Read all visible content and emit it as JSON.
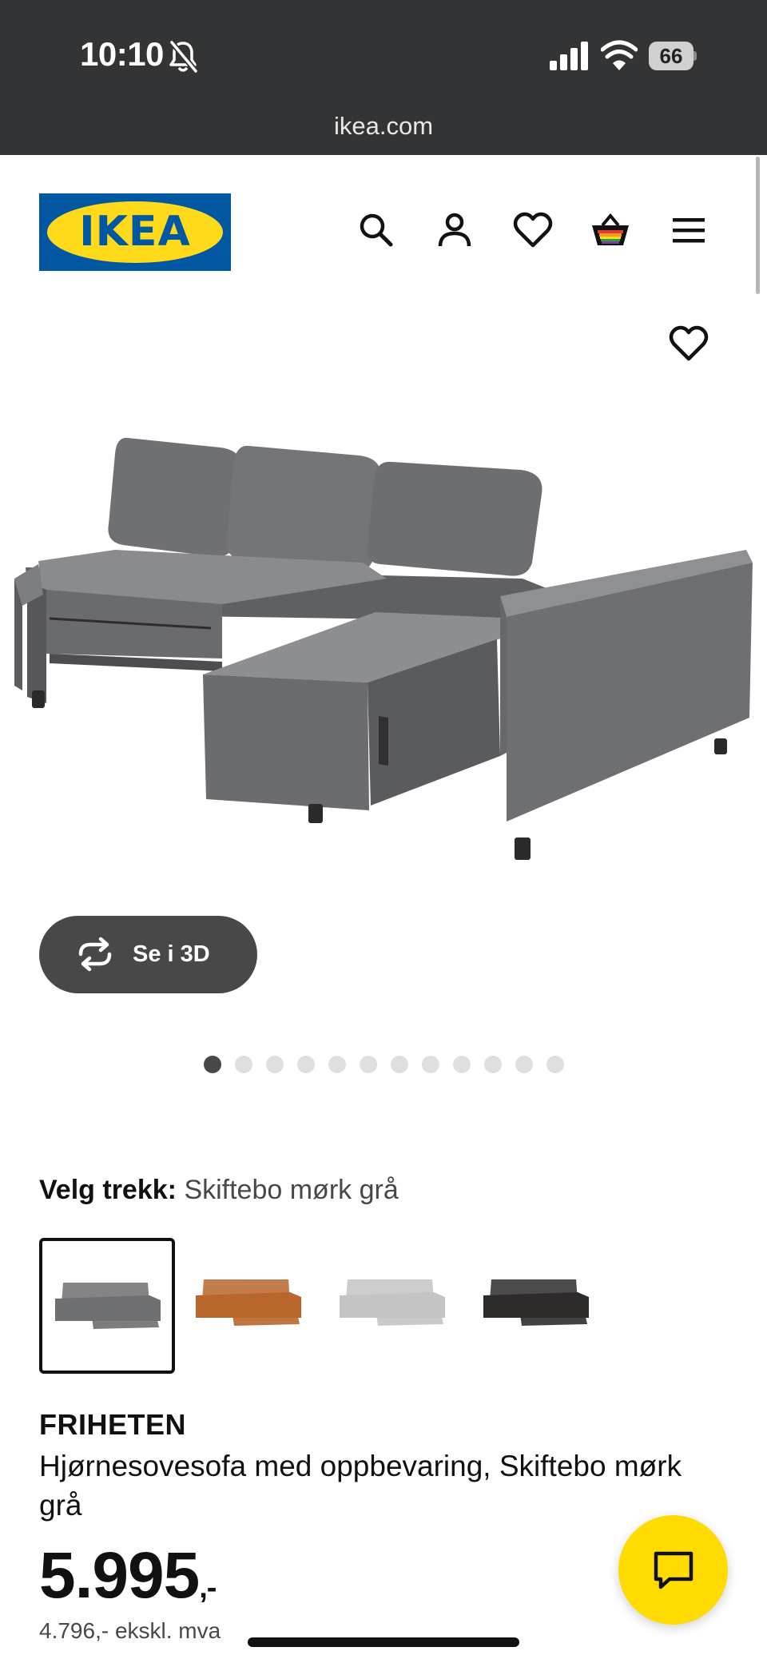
{
  "status_bar": {
    "time": "10:10",
    "battery": "66",
    "icons": [
      "bell-slash-icon",
      "cellular-signal-icon",
      "wifi-icon",
      "battery-icon"
    ]
  },
  "browser": {
    "url": "ikea.com"
  },
  "header": {
    "logo_text": "IKEA",
    "icons": [
      "search-icon",
      "account-icon",
      "heart-icon",
      "shopping-bag-icon",
      "menu-icon"
    ]
  },
  "gallery": {
    "view_3d_label": "Se i 3D",
    "slide_count": 12,
    "active_slide": 1
  },
  "cover_selection": {
    "label": "Velg trekk:",
    "value": "Skiftebo mørk grå",
    "swatches": [
      {
        "color": "#6e6f71",
        "selected": true
      },
      {
        "color": "#b8662b",
        "selected": false
      },
      {
        "color": "#c4c4c4",
        "selected": false
      },
      {
        "color": "#2e2c2b",
        "selected": false
      }
    ]
  },
  "product": {
    "name": "FRIHETEN",
    "description": "Hjørnesovesofa med oppbevaring, Skiftebo mørk grå",
    "price": "5.995",
    "price_suffix": ",-",
    "price_ex_vat": "4.796,- ekskl. mva"
  },
  "colors": {
    "ikea_blue": "#0058a3",
    "ikea_yellow": "#ffda1a",
    "chat_yellow": "#ffdb00",
    "dark_button": "#484848"
  }
}
